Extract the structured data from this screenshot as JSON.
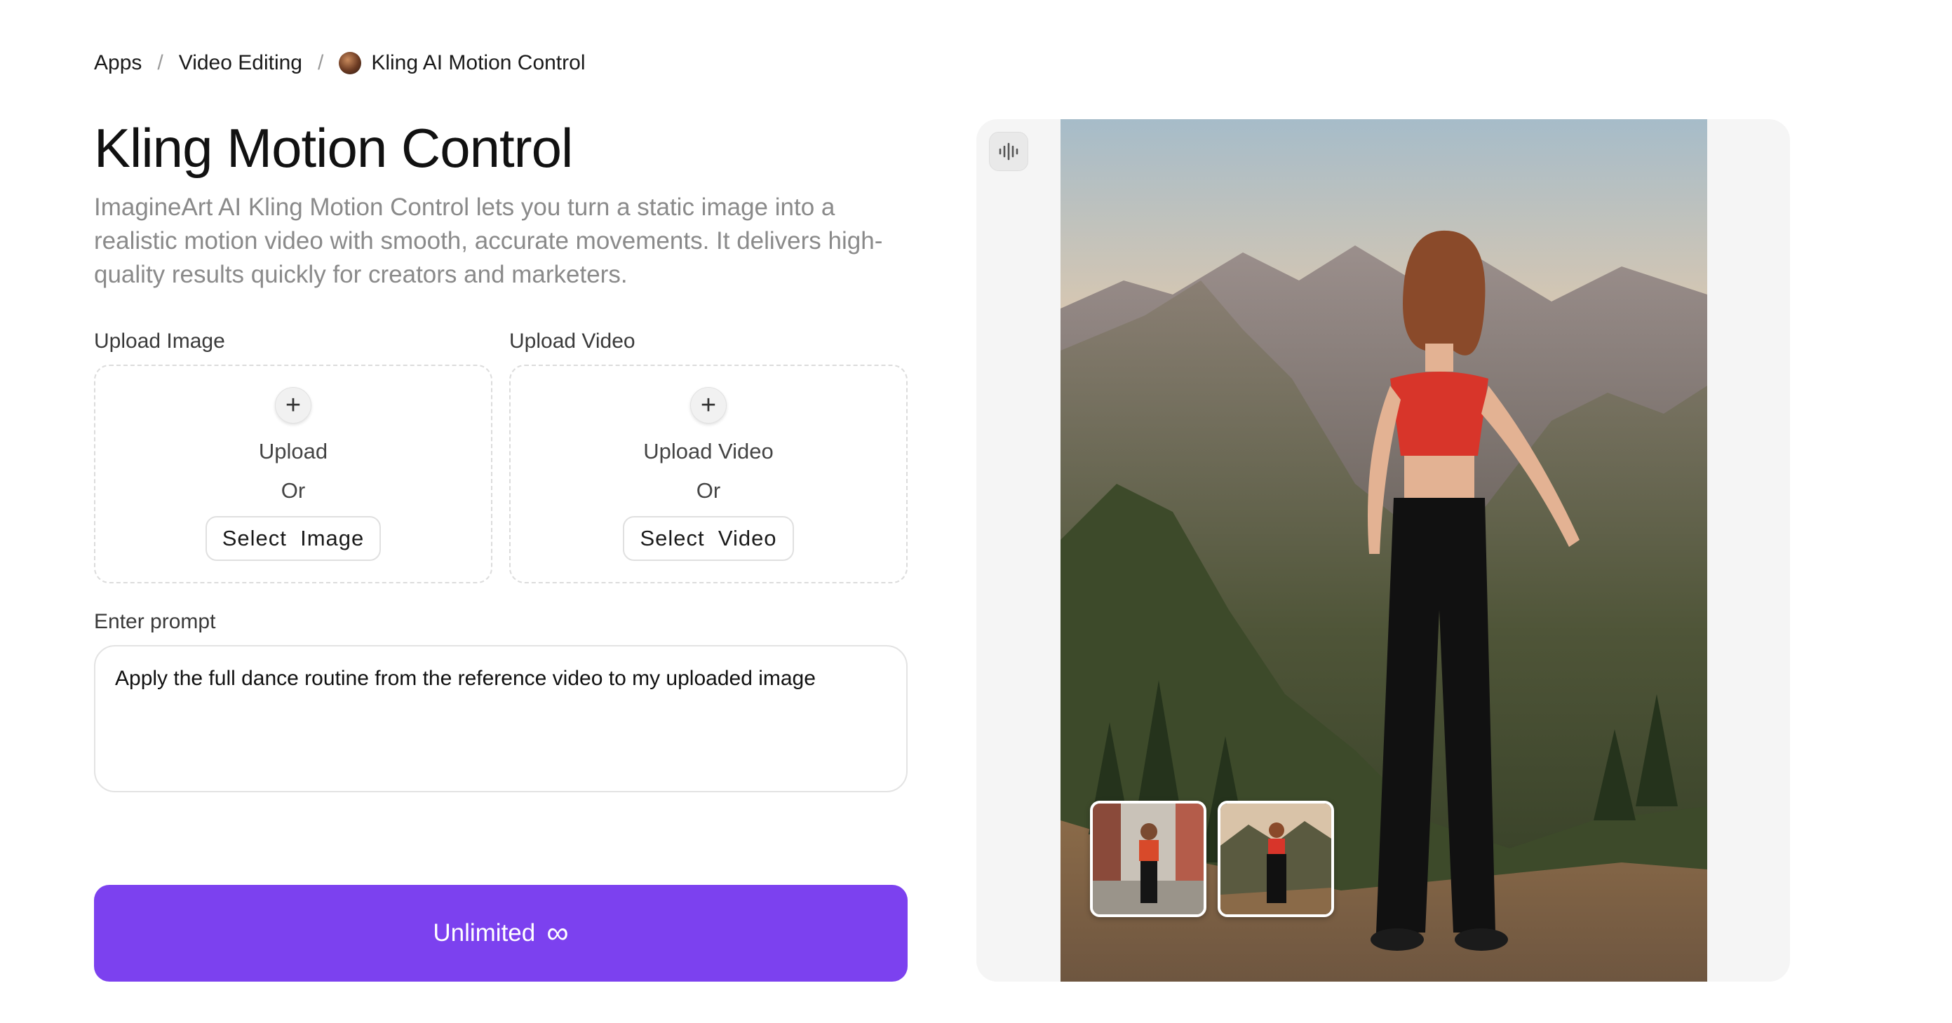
{
  "breadcrumb": {
    "items": [
      "Apps",
      "Video Editing",
      "Kling AI Motion Control"
    ],
    "separator": "/"
  },
  "header": {
    "title": "Kling Motion Control",
    "description": "ImagineArt AI Kling Motion Control lets you turn a static image into a realistic motion video with smooth, accurate movements. It delivers high-quality results quickly for creators and marketers."
  },
  "upload_image": {
    "label": "Upload Image",
    "upload_text": "Upload",
    "or_text": "Or",
    "select_label": "Select  Image"
  },
  "upload_video": {
    "label": "Upload Video",
    "upload_text": "Upload Video",
    "or_text": "Or",
    "select_label": "Select  Video"
  },
  "prompt": {
    "label": "Enter prompt",
    "value": "Apply the full dance routine from the reference video to my uploaded image"
  },
  "generate": {
    "label": "Unlimited",
    "icon": "infinity-icon",
    "color": "#7c41ef"
  },
  "preview": {
    "audio_icon": "audio-waveform-icon",
    "thumbnails": [
      "reference-video-thumbnail",
      "generated-result-thumbnail"
    ]
  },
  "colors": {
    "accent": "#7c41ef",
    "muted_text": "#8a8a8a",
    "panel_bg": "#f5f5f5"
  }
}
